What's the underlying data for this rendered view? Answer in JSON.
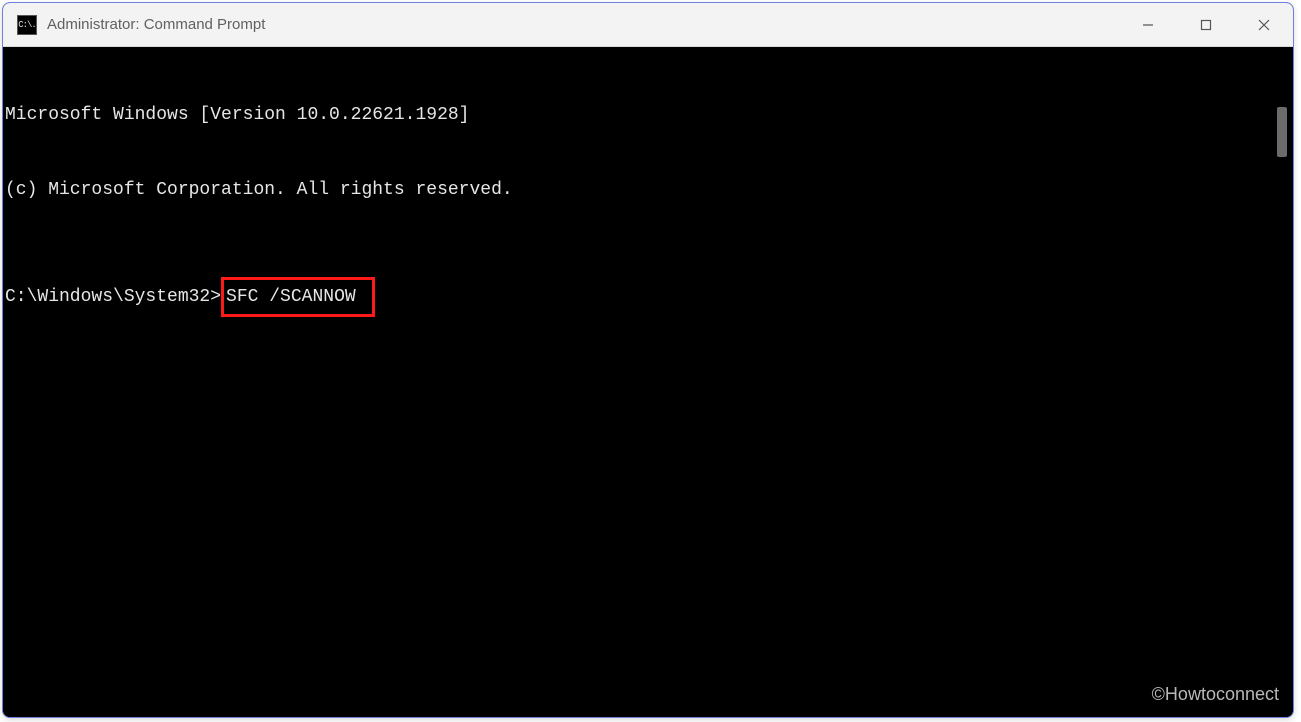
{
  "window": {
    "title": "Administrator: Command Prompt",
    "icon_glyph": "C:\\."
  },
  "terminal": {
    "line1": "Microsoft Windows [Version 10.0.22621.1928]",
    "line2": "(c) Microsoft Corporation. All rights reserved.",
    "prompt": "C:\\Windows\\System32>",
    "command": "SFC /SCANNOW"
  },
  "watermark": "©Howtoconnect"
}
